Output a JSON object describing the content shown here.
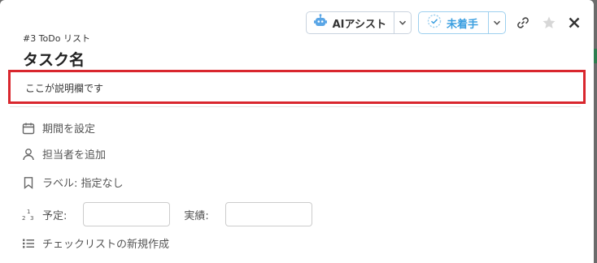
{
  "toolbar": {
    "ai_label": "AIアシスト",
    "status_label": "未着手",
    "accent": "#3b9fe0"
  },
  "task": {
    "breadcrumb": "#3 ToDo リスト",
    "title": "タスク名",
    "description": "ここが説明欄です"
  },
  "fields": {
    "due": "期間を設定",
    "assignee": "担当者を追加",
    "label": "ラベル: 指定なし",
    "planned": "予定:",
    "actual": "実績:",
    "checklist": "チェックリストの新規作成"
  },
  "icons": [
    "robot-icon",
    "chevron-down-icon",
    "check-circle-icon",
    "link-icon",
    "star-icon",
    "close-icon",
    "calendar-icon",
    "person-icon",
    "bookmark-icon",
    "numbers-icon",
    "list-icon"
  ]
}
